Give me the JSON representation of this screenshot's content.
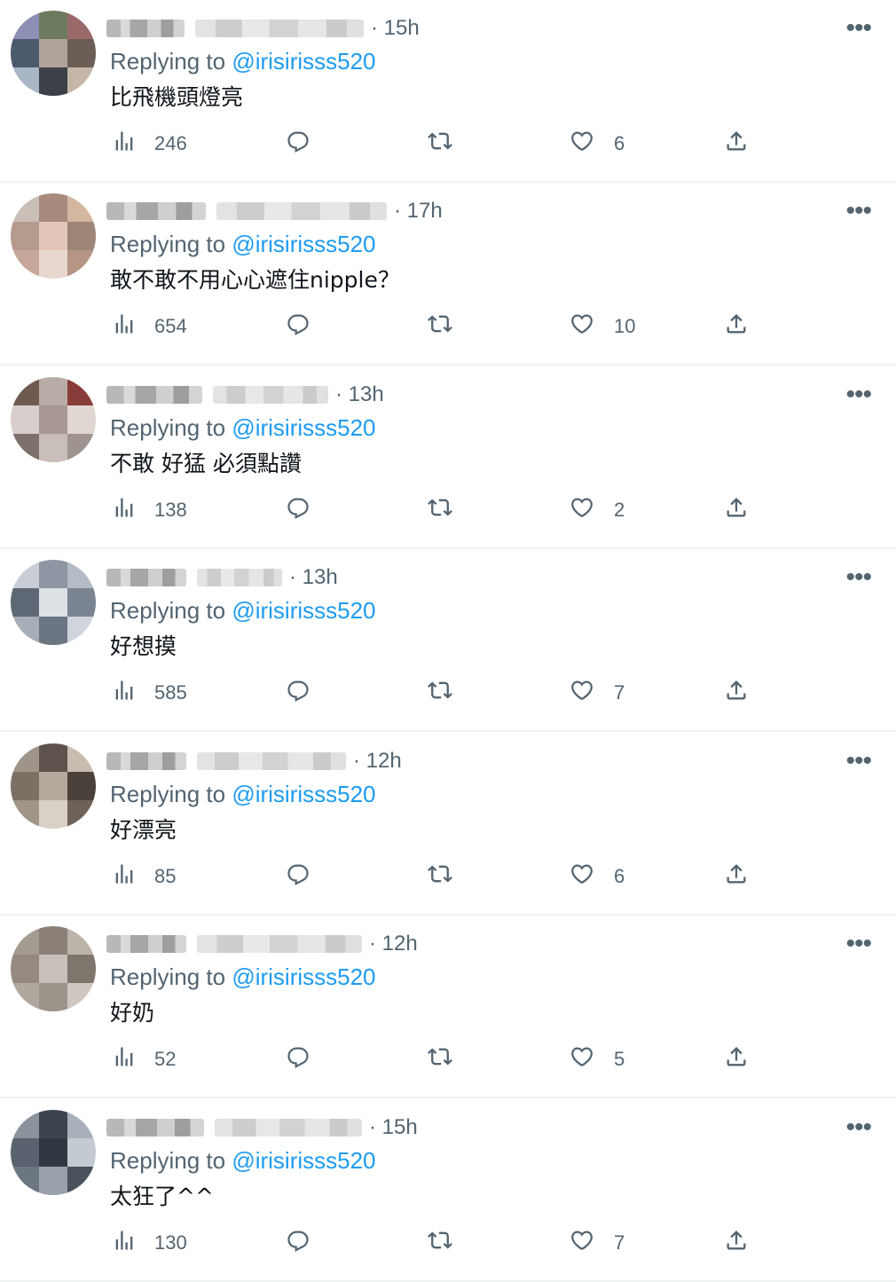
{
  "colors": {
    "accent": "#1d9bf0",
    "secondary_text": "#536471",
    "divider": "#eff3f4"
  },
  "icons": {
    "views": "bar-chart-icon",
    "reply": "speech-bubble-icon",
    "retweet": "retweet-arrows-icon",
    "like": "heart-icon",
    "share": "share-upload-icon",
    "more": "ellipsis-icon"
  },
  "reply_prefix": "Replying to",
  "tweets": [
    {
      "time": "· 15h",
      "handle": "@irisirisss520",
      "text": "比飛機頭燈亮",
      "views": "246",
      "likes": "6"
    },
    {
      "time": "· 17h",
      "handle": "@irisirisss520",
      "text": "敢不敢不用心心遮住nipple？",
      "views": "654",
      "likes": "10"
    },
    {
      "time": "· 13h",
      "handle": "@irisirisss520",
      "text": "不敢 好猛 必須點讚",
      "views": "138",
      "likes": "2"
    },
    {
      "time": "· 13h",
      "handle": "@irisirisss520",
      "text": "好想摸",
      "views": "585",
      "likes": "7"
    },
    {
      "time": "· 12h",
      "handle": "@irisirisss520",
      "text": "好漂亮",
      "views": "85",
      "likes": "6"
    },
    {
      "time": "· 12h",
      "handle": "@irisirisss520",
      "text": "好奶",
      "views": "52",
      "likes": "5"
    },
    {
      "time": "· 15h",
      "handle": "@irisirisss520",
      "text": "太狂了^^",
      "views": "130",
      "likes": "7"
    }
  ]
}
